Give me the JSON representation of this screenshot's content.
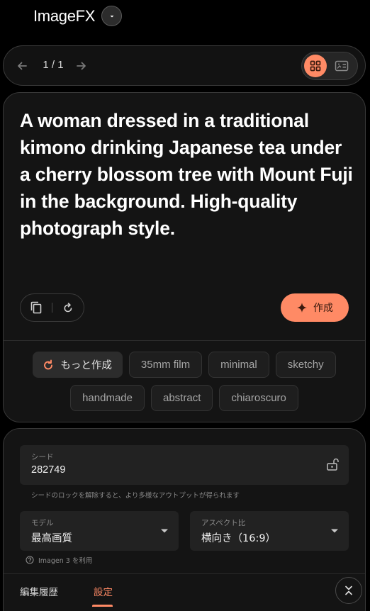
{
  "app": {
    "title": "ImageFX"
  },
  "pager": {
    "count": "1 / 1"
  },
  "prompt": {
    "text": "A woman dressed in a traditional kimono drinking Japanese tea under a cherry blossom tree with Mount Fuji in the background. High-quality photograph style.",
    "create_label": "作成"
  },
  "chips": {
    "more_label": "もっと作成",
    "items": [
      "35mm film",
      "minimal",
      "sketchy",
      "handmade",
      "abstract",
      "chiaroscuro"
    ]
  },
  "settings": {
    "seed": {
      "label": "シード",
      "value": "282749",
      "hint": "シードのロックを解除すると、より多様なアウトプットが得られます"
    },
    "model": {
      "label": "モデル",
      "value": "最高画質"
    },
    "aspect": {
      "label": "アスペクト比",
      "value": "横向き（16:9）"
    },
    "model_note": "Imagen 3 を利用"
  },
  "tabs": {
    "history": "編集履歴",
    "settings": "設定"
  },
  "colors": {
    "accent": "#ff8a65",
    "background": "#000000",
    "card": "#141414",
    "field": "#222222"
  },
  "icons": {
    "title_menu": "chevron-down-icon",
    "prev": "arrow-left-icon",
    "next": "arrow-right-icon",
    "grid_view": "grid-icon",
    "detail_view": "image-detail-icon",
    "copy": "copy-icon",
    "reset": "refresh-icon",
    "create": "sparkle-icon",
    "more": "refresh-icon",
    "lock": "unlock-icon",
    "dropdown": "caret-down-icon",
    "help": "help-circle-icon",
    "collapse": "collapse-icon"
  }
}
